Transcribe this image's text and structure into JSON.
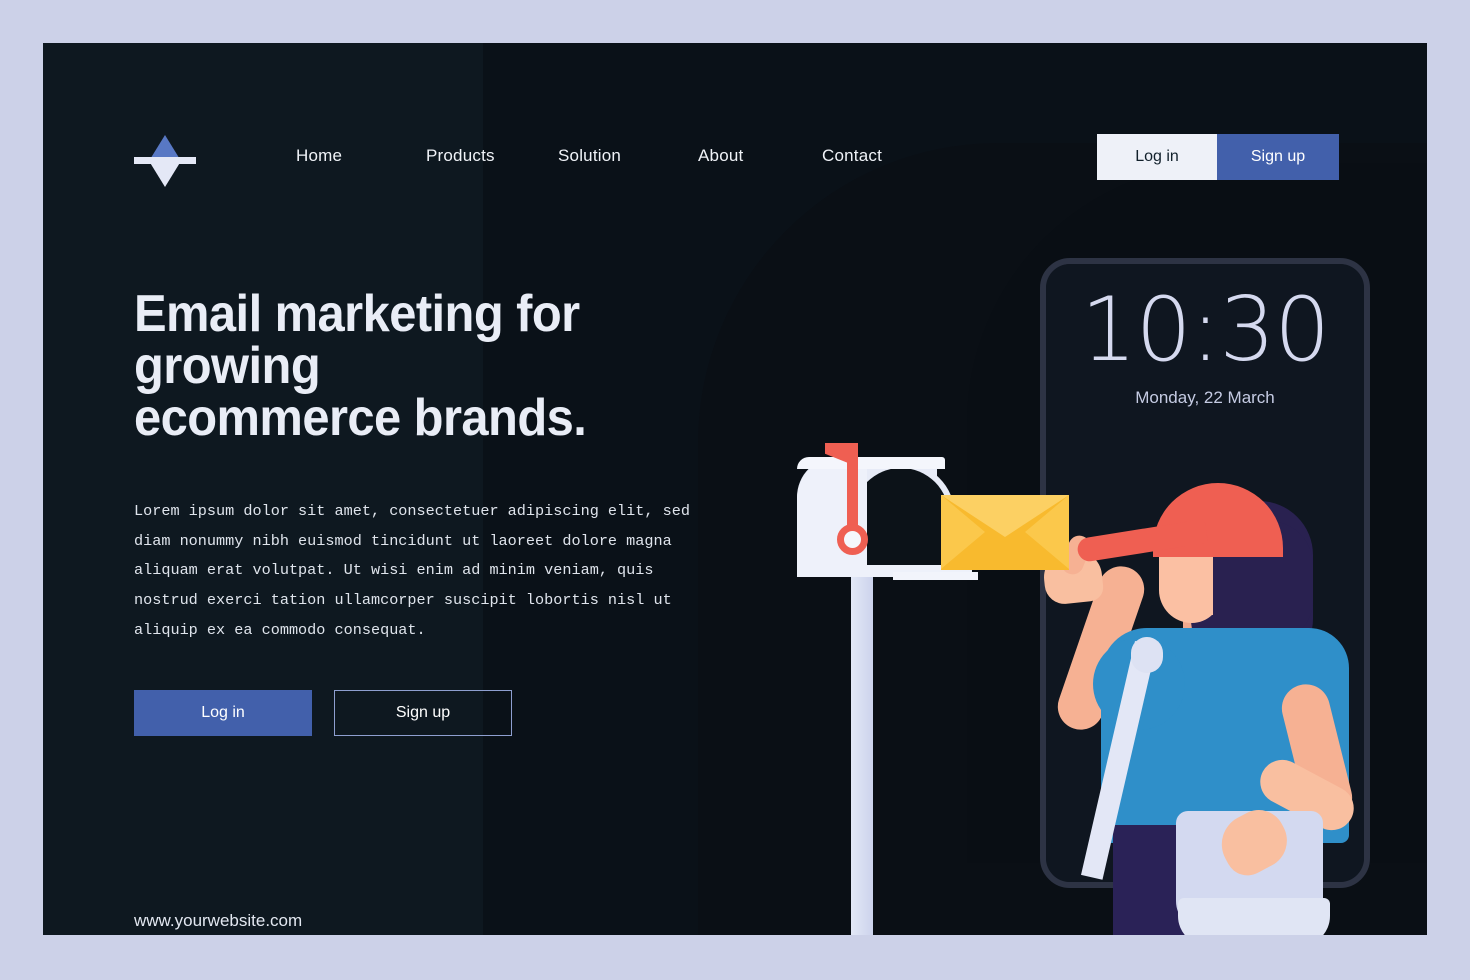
{
  "site": {
    "background_color": "#ccd1e8",
    "hero_background_color": "#0e1820",
    "accent_color": "#4260ab",
    "flag_color": "#ef5f52",
    "envelope_color": "#f8ba2e"
  },
  "navbar": {
    "logo_name": "diamond-logo",
    "links": [
      {
        "label": "Home"
      },
      {
        "label": "Products"
      },
      {
        "label": "Solution"
      },
      {
        "label": "About"
      },
      {
        "label": "Contact"
      }
    ],
    "login_label": "Log in",
    "signup_label": "Sign up"
  },
  "hero": {
    "headline": "Email marketing for growing\necommerce brands.",
    "body": "Lorem ipsum dolor sit amet, consectetuer adipiscing elit, sed diam nonummy nibh euismod tincidunt ut laoreet dolore magna aliquam erat volutpat. Ut wisi enim ad minim veniam, quis nostrud exerci tation ullamcorper suscipit lobortis nisl ut aliquip ex ea commodo consequat.",
    "cta_login_label": "Log in",
    "cta_signup_label": "Sign up",
    "website_url": "www.yourwebsite.com"
  },
  "phone": {
    "time": "10:30",
    "date": "Monday, 22 March"
  },
  "illustration": {
    "mailbox_name": "mailbox",
    "envelope_name": "envelope",
    "carrier_name": "mail-carrier"
  }
}
